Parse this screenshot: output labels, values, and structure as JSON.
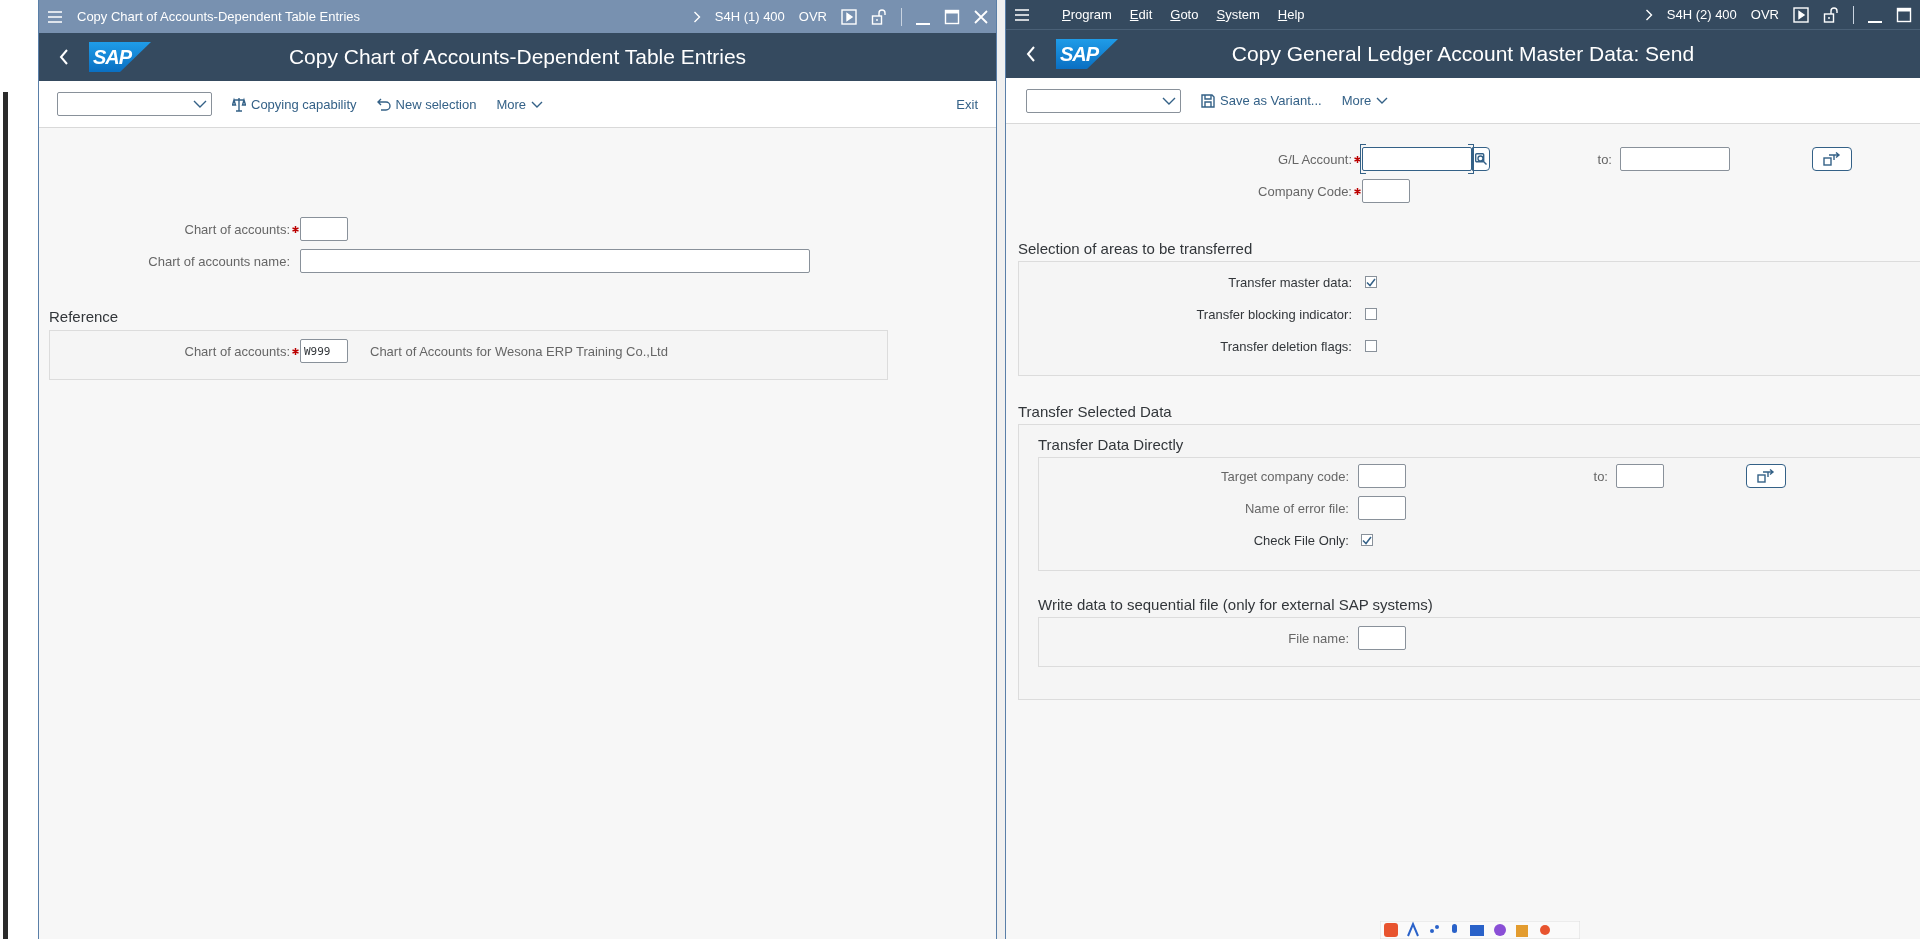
{
  "left_window": {
    "title": "Copy Chart of Accounts-Dependent Table Entries",
    "system": "S4H (1) 400",
    "mode": "OVR",
    "logo": "SAP",
    "header_title": "Copy Chart of Accounts-Dependent Table Entries",
    "toolbar": [
      {
        "kind": "dropdown"
      },
      {
        "kind": "scales",
        "label": "Copying capability"
      },
      {
        "kind": "undo",
        "label": "New selection"
      },
      {
        "kind": "more",
        "label": "More"
      },
      {
        "kind": "exit",
        "label": "Exit"
      }
    ],
    "rows": [
      {
        "kind": "code_field",
        "label": "Chart of accounts:",
        "required": true,
        "focused": false
      },
      {
        "kind": "text_field",
        "label": "Chart of accounts name:",
        "required": false,
        "focused": false
      }
    ],
    "groups": [
      {
        "title": "Reference",
        "rows": [
          {
            "kind": "code_field",
            "label": "Chart of accounts:",
            "required": true,
            "focused": false,
            "value": "W999",
            "description": "Chart of Accounts for Wesona ERP Training Co.,Ltd"
          }
        ]
      }
    ]
  },
  "right_window": {
    "menu": [
      "Program",
      "Edit",
      "Goto",
      "System",
      "Help"
    ],
    "system": "S4H (2) 400",
    "mode": "OVR",
    "logo": "SAP",
    "header_title": "Copy General Ledger Account Master Data: Send",
    "toolbar": [
      {
        "kind": "dropdown"
      },
      {
        "kind": "save",
        "label": "Save as Variant..."
      },
      {
        "kind": "more",
        "label": "More"
      }
    ],
    "rows": [
      {
        "kind": "range_search",
        "label": "G/L Account:",
        "required": true,
        "focused": true,
        "to_label": "to:"
      },
      {
        "kind": "short",
        "label": "Company Code:",
        "required": true,
        "focused": false
      }
    ],
    "groups": [
      {
        "title": "Selection of areas to be transferred",
        "rows": [
          {
            "kind": "checkbox",
            "label": "Transfer master data:",
            "checked": true
          },
          {
            "kind": "checkbox",
            "label": "Transfer blocking indicator:",
            "checked": false
          },
          {
            "kind": "checkbox",
            "label": "Transfer deletion flags:",
            "checked": false
          }
        ]
      },
      {
        "title": "Transfer Selected Data",
        "subgroups": [
          {
            "title": "Transfer Data Directly",
            "rows": [
              {
                "kind": "range",
                "label": "Target company code:",
                "required": false,
                "focused": false,
                "to_label": "to:"
              },
              {
                "kind": "short",
                "label": "Name of error file:",
                "required": false,
                "focused": false
              },
              {
                "kind": "checkbox",
                "label": "Check File Only:",
                "checked": true
              }
            ]
          },
          {
            "title": "Write data to sequential file (only for external SAP systems)",
            "rows": [
              {
                "kind": "short",
                "label": "File name:",
                "required": false,
                "focused": false
              }
            ]
          }
        ]
      }
    ]
  }
}
